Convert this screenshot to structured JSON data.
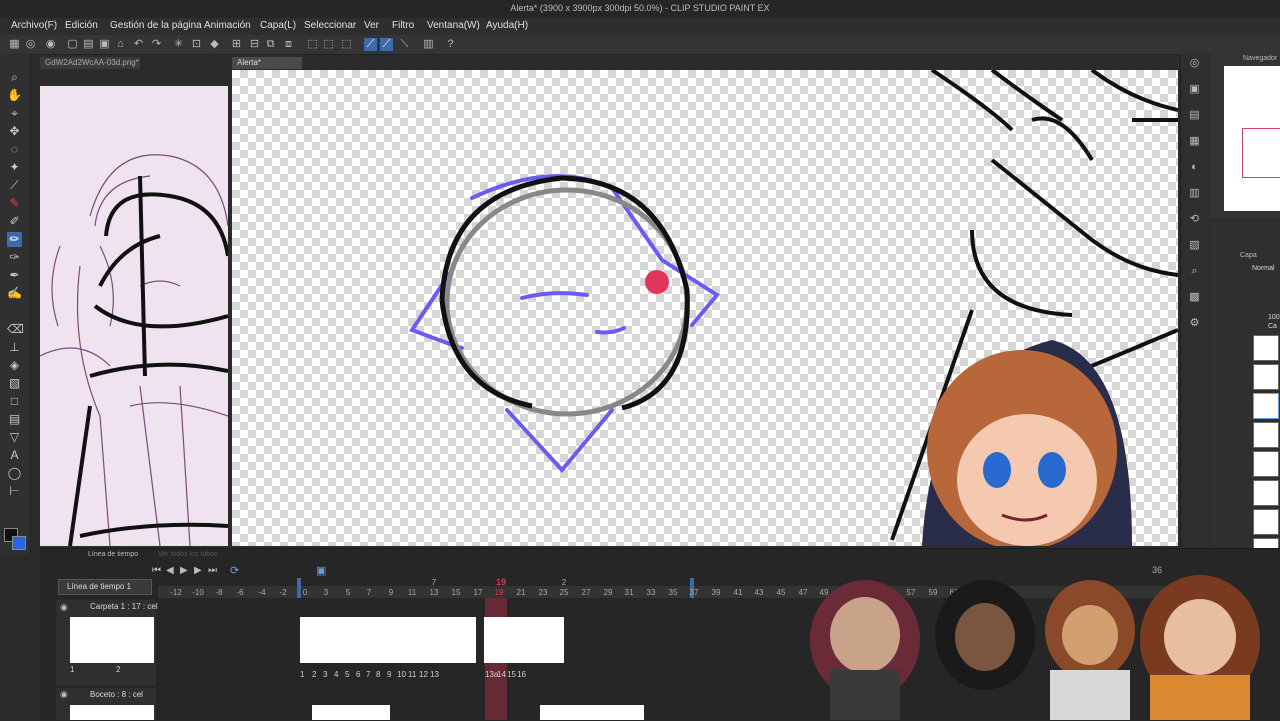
{
  "window": {
    "title": "Alerta* (3900 x 3900px 300dpi 50.0%) - CLIP STUDIO PAINT EX"
  },
  "menu": [
    "Archivo(F)",
    "Edición",
    "Gestión de la página",
    "Animación",
    "Capa(L)",
    "Seleccionar",
    "Ver",
    "Filtro",
    "Ventana(W)",
    "Ayuda(H)"
  ],
  "tabs": {
    "left_doc": "GdW2Ad2WcAA-03d.png*",
    "main_doc": "Alerta*"
  },
  "panels": {
    "navigator": "Navegador",
    "layer": "Capa",
    "blend_mode": "Normal",
    "layer_prefix": "100",
    "layer_name_short": "Ca"
  },
  "timeline": {
    "panel_title": "Línea de tiempo",
    "faint_label": "Ver todos los tubos",
    "timeline_name": "Línea de tiempo 1",
    "current_frame": "19",
    "end_label": "36",
    "ruler": [
      "-12",
      "-10",
      "-8",
      "-6",
      "-4",
      "-2",
      "0",
      "3",
      "5",
      "7",
      "9",
      "11",
      "13",
      "15",
      "17",
      "19",
      "21",
      "23",
      "25",
      "27",
      "29",
      "31",
      "33",
      "35",
      "37",
      "39",
      "41",
      "43",
      "45",
      "47",
      "49",
      "51",
      "53",
      "55",
      "57",
      "59",
      "61",
      "63"
    ],
    "top_ruler": [
      "1",
      "7",
      "13",
      "19",
      "2"
    ],
    "tracks": [
      {
        "name": "Carpeta 1 : 17 : cel",
        "left_cels": [
          "1",
          "2"
        ],
        "cels": [
          "1",
          "2",
          "3",
          "4",
          "5",
          "6",
          "7",
          "8",
          "9",
          "10",
          "11",
          "12",
          "13",
          "13a",
          "14",
          "15",
          "16"
        ]
      },
      {
        "name": "Boceto : 8 : cel"
      }
    ]
  },
  "colors": {
    "accent": "#3d6aa8",
    "sketch_blue": "#6a5cf0",
    "playhead": "#e0345a",
    "panel_bg": "#2b2b2b"
  },
  "icons": [
    "undo-icon",
    "redo-icon",
    "zoom-icon",
    "hand-icon",
    "move-icon",
    "lasso-icon",
    "pen-icon",
    "eraser-icon",
    "fill-icon",
    "text-icon",
    "play-icon"
  ]
}
